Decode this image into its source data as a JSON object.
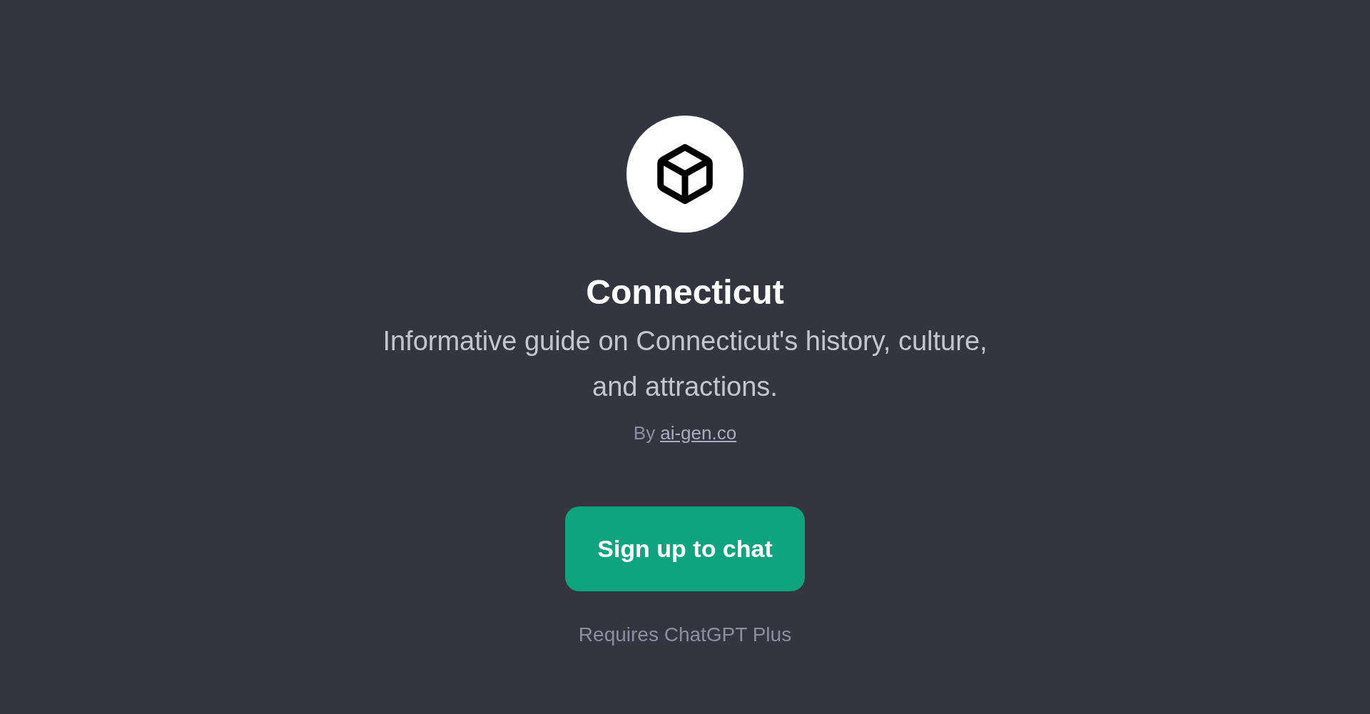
{
  "gpt": {
    "title": "Connecticut",
    "description": "Informative guide on Connecticut's history, culture, and attractions.",
    "author_prefix": "By",
    "author_link": "ai-gen.co"
  },
  "signup_button": "Sign up to chat",
  "requirement": "Requires ChatGPT Plus"
}
